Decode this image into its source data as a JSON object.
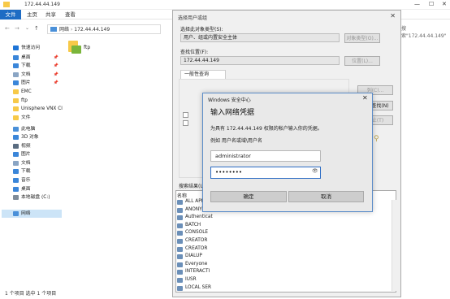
{
  "explorer": {
    "title": "172.44.44.149",
    "ribbon_tabs": [
      "文件",
      "主页",
      "共享",
      "查看"
    ],
    "address_segments": [
      "网络",
      "172.44.44.149"
    ],
    "search_placeholder": "搜索\"172.44.44.149\"",
    "folder_name": "ftp",
    "status": "1 个项目   选中 1 个项目"
  },
  "nav": {
    "items": [
      {
        "label": "快速访问",
        "color": "#1e74d6",
        "pinned": false
      },
      {
        "label": "桌面",
        "color": "#3b86d9",
        "pinned": true
      },
      {
        "label": "下载",
        "color": "#3b86d9",
        "pinned": true
      },
      {
        "label": "文档",
        "color": "#8aa5c4",
        "pinned": true
      },
      {
        "label": "图片",
        "color": "#3b86d9",
        "pinned": true
      },
      {
        "label": "EMC",
        "color": "#f7c948",
        "pinned": false
      },
      {
        "label": "ftp",
        "color": "#f7c948",
        "pinned": false
      },
      {
        "label": "Unisphere VNX Cl",
        "color": "#f7c948",
        "pinned": false
      },
      {
        "label": "文件",
        "color": "#f7c948",
        "pinned": false
      },
      {
        "label": "此电脑",
        "color": "#4a90d9",
        "pinned": false
      },
      {
        "label": "3D 对象",
        "color": "#3b86d9",
        "pinned": false
      },
      {
        "label": "视频",
        "color": "#5a6c80",
        "pinned": false
      },
      {
        "label": "图片",
        "color": "#3b86d9",
        "pinned": false
      },
      {
        "label": "文档",
        "color": "#8aa5c4",
        "pinned": false
      },
      {
        "label": "下载",
        "color": "#3b86d9",
        "pinned": false
      },
      {
        "label": "音乐",
        "color": "#3b86d9",
        "pinned": false
      },
      {
        "label": "桌面",
        "color": "#3b86d9",
        "pinned": false
      },
      {
        "label": "本地磁盘 (C:)",
        "color": "#7f8c99",
        "pinned": false
      },
      {
        "label": "网络",
        "color": "#4a90d9",
        "pinned": false,
        "selected": true
      }
    ]
  },
  "select_dialog": {
    "title": "选择用户或组",
    "object_type_label": "选择此对象类型(S):",
    "object_type_value": "用户、组或内置安全主体",
    "object_type_button": "对象类型(O)...",
    "location_label": "查找位置(F):",
    "location_value": "172.44.44.149",
    "location_button": "位置(L)...",
    "tab": "一般性查询",
    "columns_button": "列(C)...",
    "find_button": "立即查找(N)",
    "stop_button": "停止(T)",
    "results_label": "搜索结果(U):",
    "results_col": "名称",
    "results": [
      "ALL APP",
      "ANONYM",
      "Authenticat",
      "BATCH",
      "CONSOLE",
      "CREATOR",
      "CREATOR",
      "DIALUP",
      "Everyone",
      "INTERACTI",
      "IUSR",
      "LOCAL SER"
    ]
  },
  "credentials": {
    "window_title": "Windows 安全中心",
    "heading": "输入网络凭据",
    "prompt": "为具有 172.44.44.149 权限的帐户输入你的凭据。",
    "example": "例如 用户名或域\\用户名",
    "username": "administrator",
    "password_mask": "••••••••",
    "ok": "确定",
    "cancel": "取消"
  }
}
